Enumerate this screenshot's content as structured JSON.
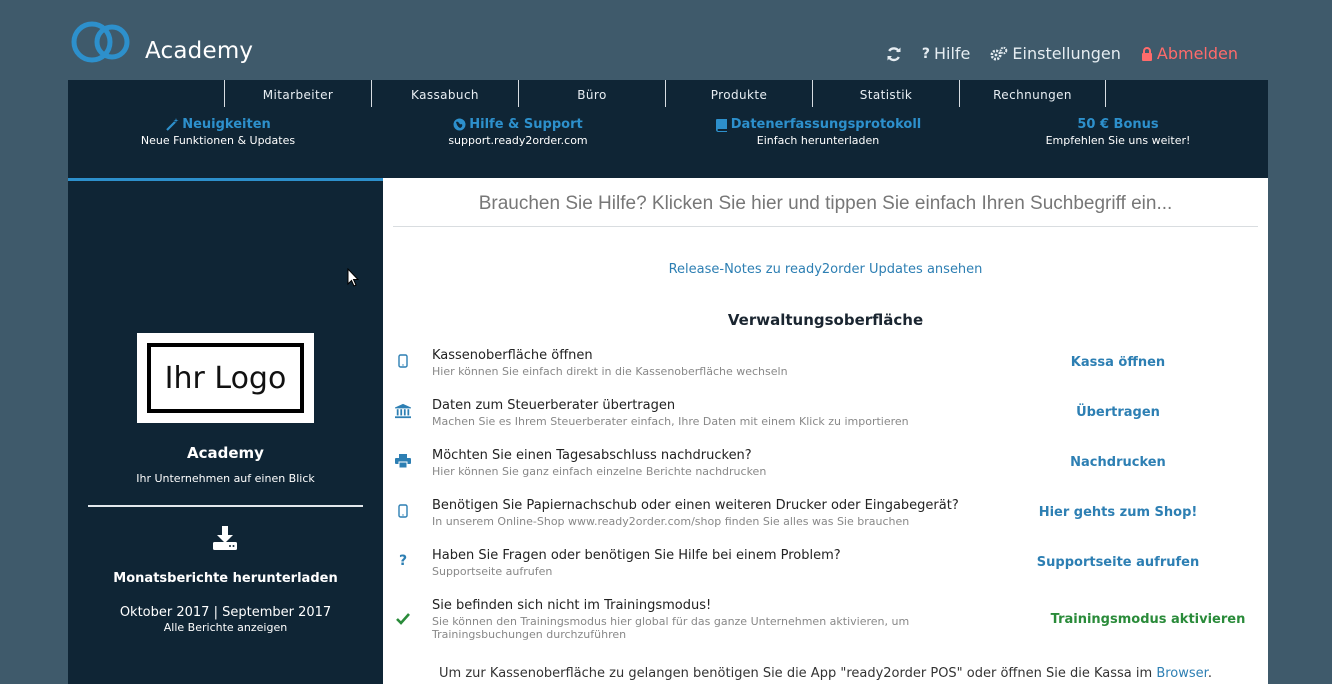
{
  "brand": "Academy",
  "topnav": {
    "help": "Hilfe",
    "settings": "Einstellungen",
    "logout": "Abmelden"
  },
  "tabs": [
    "Mitarbeiter",
    "Kassabuch",
    "Büro",
    "Produkte",
    "Statistik",
    "Rechnungen"
  ],
  "features": [
    {
      "title": "Neuigkeiten",
      "sub": "Neue Funktionen & Updates",
      "icon": "magic-wand-icon"
    },
    {
      "title": "Hilfe & Support",
      "sub": "support.ready2order.com",
      "icon": "globe-icon"
    },
    {
      "title": "Datenerfassungsprotokoll",
      "sub": "Einfach herunterladen",
      "icon": "book-icon"
    },
    {
      "title": "50 € Bonus",
      "sub": "Empfehlen Sie uns weiter!",
      "icon": ""
    }
  ],
  "sidebar": {
    "logo_text": "Ihr Logo",
    "company": "Academy",
    "tagline": "Ihr Unternehmen auf einen Blick",
    "reports_title": "Monatsberichte herunterladen",
    "months": "Oktober 2017 | September 2017",
    "all_reports": "Alle Berichte anzeigen"
  },
  "content": {
    "search_placeholder": "Brauchen Sie Hilfe? Klicken Sie hier und tippen Sie einfach Ihren Suchbegriff ein...",
    "release_notes": "Release-Notes zu ready2order Updates ansehen",
    "section_title": "Verwaltungsoberfläche",
    "rows": [
      {
        "icon": "tablet-icon",
        "title": "Kassenoberfläche öffnen",
        "sub": "Hier können Sie einfach direkt in die Kassenoberfläche wechseln",
        "action": "Kassa öffnen"
      },
      {
        "icon": "bank-icon",
        "title": "Daten zum Steuerberater übertragen",
        "sub": "Machen Sie es Ihrem Steuerberater einfach, Ihre Daten mit einem Klick zu importieren",
        "action": "Übertragen"
      },
      {
        "icon": "printer-icon",
        "title": "Möchten Sie einen Tagesabschluss nachdrucken?",
        "sub": "Hier können Sie ganz einfach einzelne Berichte nachdrucken",
        "action": "Nachdrucken"
      },
      {
        "icon": "tablet-icon",
        "title": "Benötigen Sie Papiernachschub oder einen weiteren Drucker oder Eingabegerät?",
        "sub": "In unserem Online-Shop www.ready2order.com/shop finden Sie alles was Sie brauchen",
        "action": "Hier gehts zum Shop!"
      },
      {
        "icon": "question-icon",
        "title": "Haben Sie Fragen oder benötigen Sie Hilfe bei einem Problem?",
        "sub": "Supportseite aufrufen",
        "action": "Supportseite aufrufen"
      },
      {
        "icon": "check-icon",
        "title": "Sie befinden sich nicht im Trainingsmodus!",
        "sub": "Sie können den Trainingsmodus hier global für das ganze Unternehmen aktivieren, um Trainingsbuchungen durchzuführen",
        "action": "Trainingsmodus aktivieren"
      }
    ],
    "footer_text": "Um zur Kassenoberfläche zu gelangen benötigen Sie die App \"ready2order POS\" oder öffnen Sie die Kassa im",
    "footer_link": "Browser",
    "footer_end": "."
  },
  "colors": {
    "background": "#3f5a6b",
    "panel": "#0f2535",
    "accent": "#2d90cc",
    "logout": "#ff6b6b",
    "success": "#2a8b3a"
  }
}
